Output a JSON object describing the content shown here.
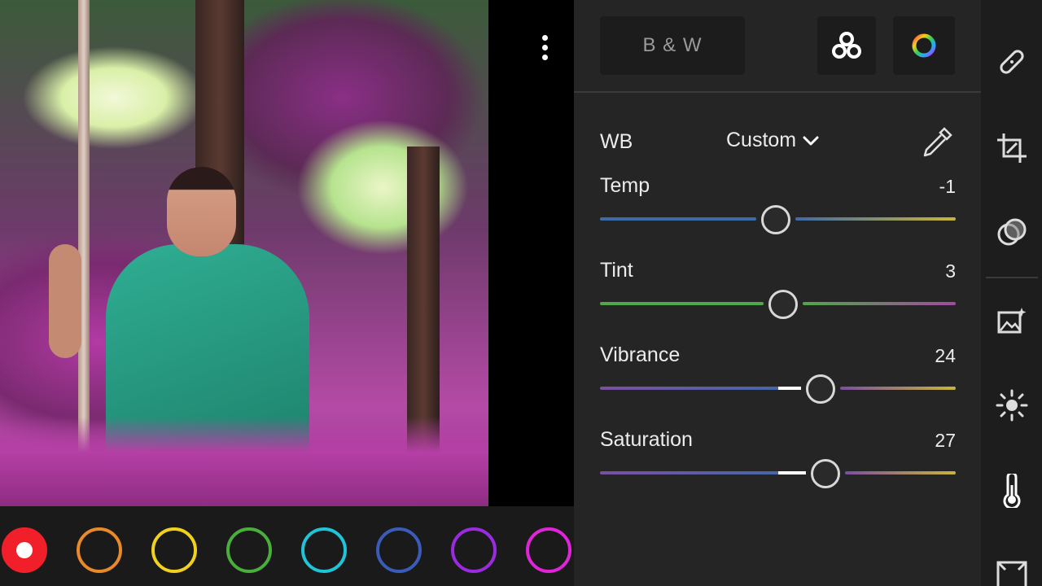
{
  "photo": {
    "subject": "",
    "more_menu": "more-vertical"
  },
  "swatches": [
    {
      "name": "red",
      "color": "#f01f2a",
      "selected": true
    },
    {
      "name": "orange",
      "color": "#e8892a",
      "selected": false
    },
    {
      "name": "yellow",
      "color": "#f0d21e",
      "selected": false
    },
    {
      "name": "green",
      "color": "#4aae3c",
      "selected": false
    },
    {
      "name": "aqua",
      "color": "#1fc4d8",
      "selected": false
    },
    {
      "name": "blue",
      "color": "#3a5bb8",
      "selected": false
    },
    {
      "name": "purple",
      "color": "#9a2be0",
      "selected": false
    },
    {
      "name": "magenta",
      "color": "#e025d8",
      "selected": false
    }
  ],
  "panel": {
    "bw_label": "B & W",
    "mix_icon": "color-mix-icon",
    "grading_icon": "color-grading-icon",
    "wb_label": "WB",
    "wb_value": "Custom",
    "eyedropper_icon": "eyedropper-icon"
  },
  "sliders": [
    {
      "label": "Temp",
      "value": "-1",
      "position": 0.495,
      "fill": false,
      "colors": [
        "#3f6aa8",
        "#c9b43a"
      ]
    },
    {
      "label": "Tint",
      "value": "3",
      "position": 0.515,
      "fill": false,
      "colors": [
        "#4fa84a",
        "#a24aa0"
      ]
    },
    {
      "label": "Vibrance",
      "value": "24",
      "position": 0.62,
      "fill": true,
      "colors": [
        "#7a4fa0",
        "#c9b43a"
      ]
    },
    {
      "label": "Saturation",
      "value": "27",
      "position": 0.635,
      "fill": true,
      "colors": [
        "#7a4fa0",
        "#c9b43a"
      ]
    }
  ],
  "rail": [
    {
      "name": "healing-icon"
    },
    {
      "name": "crop-icon"
    },
    {
      "name": "masking-icon"
    },
    {
      "name": "presets-icon"
    },
    {
      "name": "light-icon"
    },
    {
      "name": "color-icon",
      "active": true
    },
    {
      "name": "effects-icon"
    }
  ]
}
